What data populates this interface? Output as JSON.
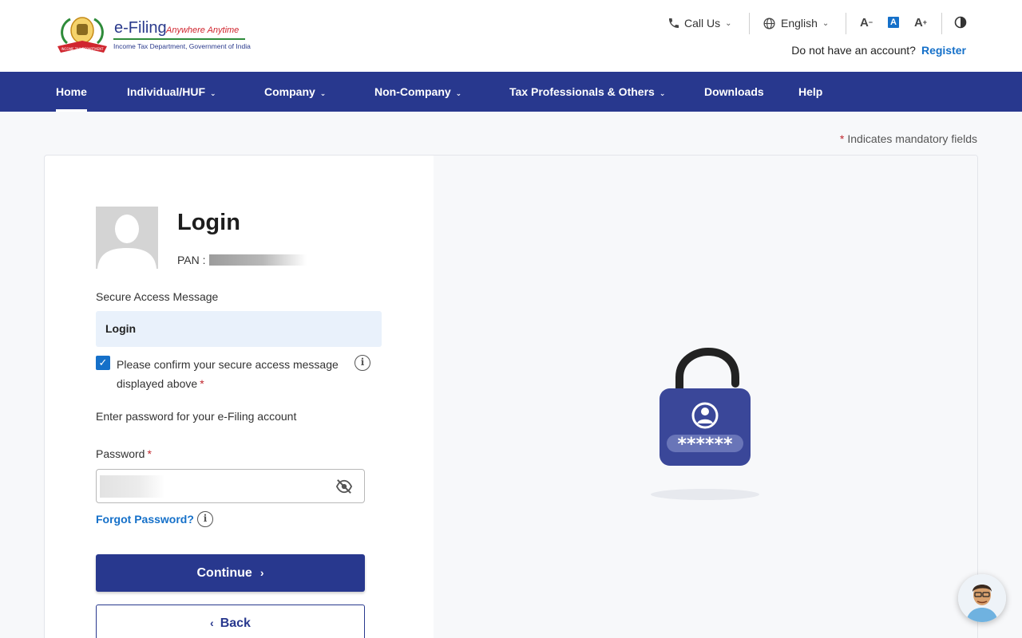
{
  "header": {
    "logo": {
      "title": "e-Filing",
      "tagline": "Anywhere Anytime",
      "subtitle": "Income Tax Department, Government of India",
      "emblem_text": "INCOME TAX DEPARTMENT"
    },
    "call_us": "Call Us",
    "language": "English",
    "font_decrease": "A",
    "font_default": "A",
    "font_increase": "A",
    "account_prompt": "Do not have an account?",
    "register": "Register"
  },
  "nav": {
    "items": [
      {
        "label": "Home",
        "dropdown": false,
        "active": true
      },
      {
        "label": "Individual/HUF",
        "dropdown": true
      },
      {
        "label": "Company",
        "dropdown": true
      },
      {
        "label": "Non-Company",
        "dropdown": true
      },
      {
        "label": "Tax Professionals & Others",
        "dropdown": true
      },
      {
        "label": "Downloads",
        "dropdown": false
      },
      {
        "label": "Help",
        "dropdown": false
      }
    ]
  },
  "mandatory_note": "Indicates mandatory fields",
  "login": {
    "title": "Login",
    "pan_label": "PAN :",
    "secure_access_label": "Secure Access Message",
    "secure_access_message": "Login",
    "confirm_text": "Please confirm your secure access message displayed above",
    "confirm_checked": true,
    "enter_password_text": "Enter password for your e-Filing account",
    "password_label": "Password",
    "forgot_password": "Forgot Password?",
    "continue": "Continue",
    "back": "Back"
  },
  "illustration": {
    "password_mask": "******"
  },
  "colors": {
    "primary": "#28388e",
    "link": "#1570c9",
    "required": "#c0262d",
    "secure_box": "#e9f1fb"
  }
}
